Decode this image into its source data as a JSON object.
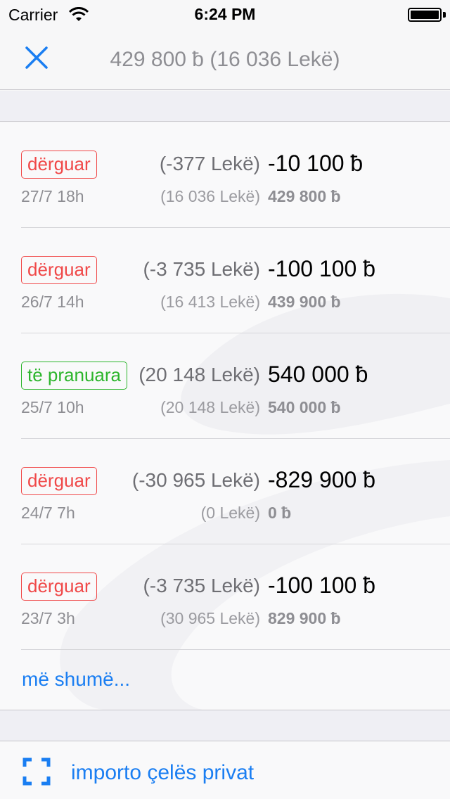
{
  "status_bar": {
    "carrier": "Carrier",
    "time": "6:24 PM",
    "wifi_icon": "wifi-icon",
    "battery_icon": "battery-icon",
    "battery_level": 1.0
  },
  "nav": {
    "close_icon": "close-icon",
    "title": "429 800 ƀ (16 036 Lekë)"
  },
  "colors": {
    "accent": "#1a7ef2",
    "sent": "#f04848",
    "received": "#2cb52c"
  },
  "transactions": [
    {
      "label": "dërguar",
      "kind": "sent",
      "fiat": "(-377 Lekë)",
      "amount": "-10 100 ƀ",
      "date": "27/7 18h",
      "balance_fiat": "(16 036 Lekë)",
      "balance": "429 800 ƀ"
    },
    {
      "label": "dërguar",
      "kind": "sent",
      "fiat": "(-3 735 Lekë)",
      "amount": "-100 100 ƀ",
      "date": "26/7 14h",
      "balance_fiat": "(16 413 Lekë)",
      "balance": "439 900 ƀ"
    },
    {
      "label": "të pranuara",
      "kind": "received",
      "fiat": "(20 148 Lekë)",
      "amount": "540 000 ƀ",
      "date": "25/7 10h",
      "balance_fiat": "(20 148 Lekë)",
      "balance": "540 000 ƀ"
    },
    {
      "label": "dërguar",
      "kind": "sent",
      "fiat": "(-30 965 Lekë)",
      "amount": "-829 900 ƀ",
      "date": "24/7 7h",
      "balance_fiat": "(0 Lekë)",
      "balance": "0 ƀ"
    },
    {
      "label": "dërguar",
      "kind": "sent",
      "fiat": "(-3 735 Lekë)",
      "amount": "-100 100 ƀ",
      "date": "23/7 3h",
      "balance_fiat": "(30 965 Lekë)",
      "balance": "829 900 ƀ"
    }
  ],
  "more_label": "më shumë...",
  "import": {
    "icon": "scan-icon",
    "label": "importo çelës privat"
  }
}
